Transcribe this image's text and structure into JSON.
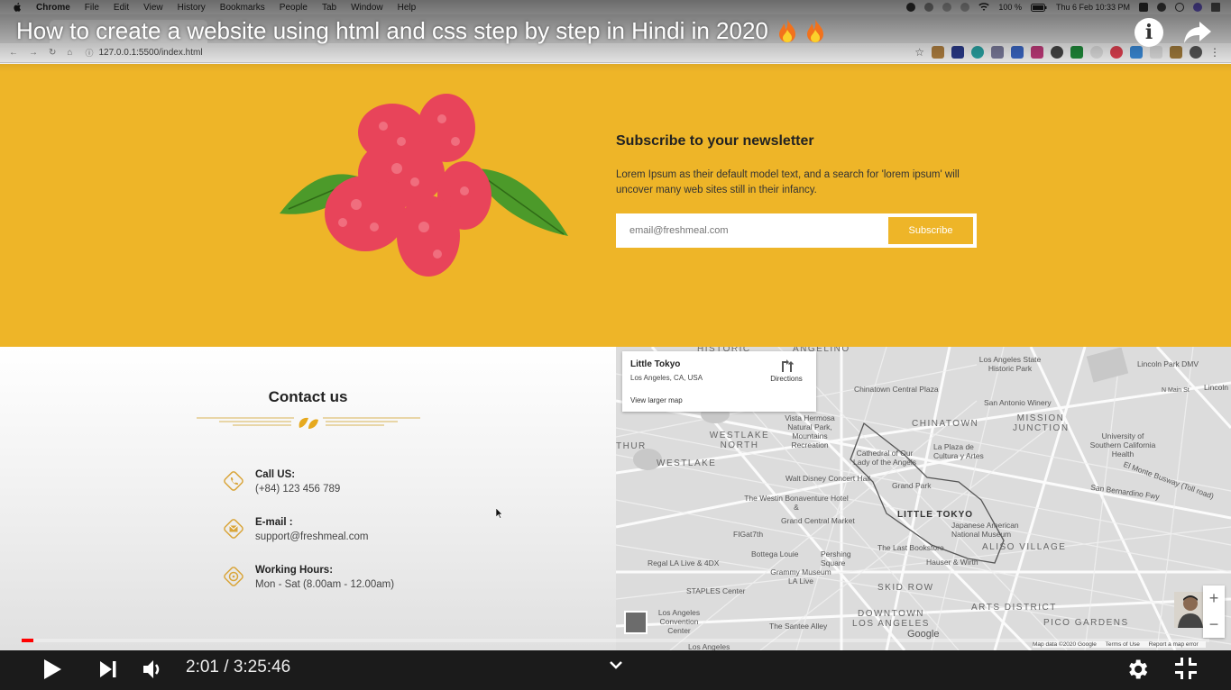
{
  "mac_menu": {
    "app": "Chrome",
    "items": [
      "File",
      "Edit",
      "View",
      "History",
      "Bookmarks",
      "People",
      "Tab",
      "Window",
      "Help"
    ],
    "battery": "100 %",
    "datetime": "Thu 6 Feb  10:33 PM"
  },
  "browser": {
    "url": "127.0.0.1:5500/index.html"
  },
  "video": {
    "title": "How to create a website using html and css step by step in Hindi in 2020",
    "time": "2:01 / 3:25:46",
    "progress_fraction": 0.0098
  },
  "newsletter": {
    "title": "Subscribe to your newsletter",
    "text": "Lorem Ipsum as their default model text, and a search for 'lorem ipsum' will uncover many web sites still in their infancy.",
    "email_placeholder": "email@freshmeal.com",
    "button": "Subscribe"
  },
  "contact": {
    "title": "Contact us",
    "items": [
      {
        "label": "Call US:",
        "value": "(+84) 123 456 789",
        "icon": "phone-icon"
      },
      {
        "label": "E-mail :",
        "value": "support@freshmeal.com",
        "icon": "mail-icon"
      },
      {
        "label": "Working Hours:",
        "value": "Mon - Sat (8.00am - 12.00am)",
        "icon": "clock-icon"
      }
    ]
  },
  "map": {
    "place": "Little Tokyo",
    "address": "Los Angeles, CA, USA",
    "directions": "Directions",
    "larger": "View larger map",
    "labels": {
      "historic": "HISTORIC",
      "angelino": "ANGELINO",
      "la_state_park": "Los Angeles State Historic Park",
      "lincoln_park_dmv": "Lincoln Park DMV",
      "chinatown_plaza": "Chinatown Central Plaza",
      "n_main": "N Main St",
      "lincoln": "Lincoln",
      "san_antonio_winery": "San Antonio Winery",
      "chinatown": "CHINATOWN",
      "mission_junction": "MISSION JUNCTION",
      "vista_hermosa": "Vista Hermosa Natural Park, Mountains Recreation",
      "westlake_north": "WESTLAKE NORTH",
      "cathedral": "Cathedral of Our Lady of the Angels",
      "la_plaza": "La Plaza de Cultura y Artes",
      "usc_health": "University of Southern California Health",
      "westlake": "WESTLAKE",
      "thur": "THUR",
      "disney_hall": "Walt Disney Concert Hall",
      "grand_park": "Grand Park",
      "el_monte": "El Monte Busway (Toll road)",
      "san_bernardino": "San Bernardino Fwy",
      "westin": "The Westin Bonaventure Hotel &",
      "little_tokyo": "LITTLE TOKYO",
      "japanese_museum": "Japanese American National Museum",
      "grand_central": "Grand Central Market",
      "figat7th": "FIGat7th",
      "pershing": "Pershing Square",
      "last_bookstore": "The Last Bookstore",
      "bottega": "Bottega Louie",
      "hauser": "Hauser & Wirth",
      "aliso_village": "ALISO VILLAGE",
      "regal": "Regal LA Live & 4DX",
      "grammy": "Grammy Museum LA Live",
      "staples": "STAPLES Center",
      "skid_row": "SKID ROW",
      "arts_district": "ARTS DISTRICT",
      "convention": "Los Angeles Convention Center",
      "downtown": "DOWNTOWN LOS ANGELES",
      "pico_gardens": "PICO GARDENS",
      "santee": "The Santee Alley",
      "los_angeles": "Los Angeles"
    },
    "google": "Google",
    "attribution": [
      "Map data ©2020 Google",
      "Terms of Use",
      "Report a map error"
    ]
  },
  "colors": {
    "accent": "#eeb528",
    "progress": "#ff0000"
  }
}
